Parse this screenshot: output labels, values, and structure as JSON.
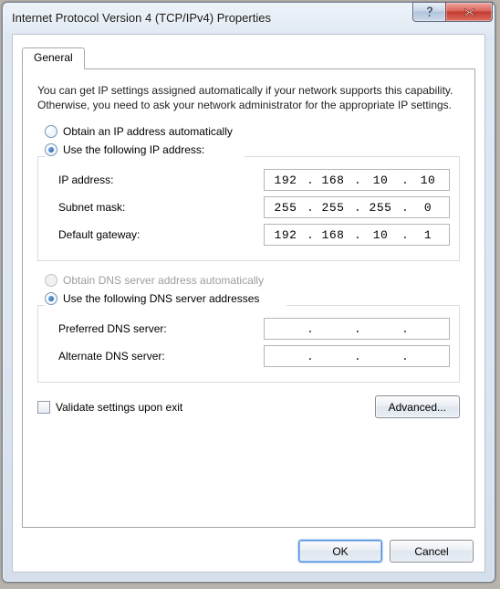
{
  "window": {
    "title": "Internet Protocol Version 4 (TCP/IPv4) Properties"
  },
  "tab": {
    "general": "General"
  },
  "intro": "You can get IP settings assigned automatically if your network supports this capability. Otherwise, you need to ask your network administrator for the appropriate IP settings.",
  "ipSection": {
    "optAuto": "Obtain an IP address automatically",
    "optManual": "Use the following IP address:",
    "fields": {
      "ipLabel": "IP address:",
      "ip": {
        "o1": "192",
        "o2": "168",
        "o3": "10",
        "o4": "10"
      },
      "maskLabel": "Subnet mask:",
      "mask": {
        "o1": "255",
        "o2": "255",
        "o3": "255",
        "o4": "0"
      },
      "gwLabel": "Default gateway:",
      "gw": {
        "o1": "192",
        "o2": "168",
        "o3": "10",
        "o4": "1"
      }
    }
  },
  "dnsSection": {
    "optAuto": "Obtain DNS server address automatically",
    "optManual": "Use the following DNS server addresses",
    "fields": {
      "prefLabel": "Preferred DNS server:",
      "pref": {
        "o1": "",
        "o2": "",
        "o3": "",
        "o4": ""
      },
      "altLabel": "Alternate DNS server:",
      "alt": {
        "o1": "",
        "o2": "",
        "o3": "",
        "o4": ""
      }
    }
  },
  "validate": "Validate settings upon exit",
  "buttons": {
    "advanced": "Advanced...",
    "ok": "OK",
    "cancel": "Cancel"
  }
}
